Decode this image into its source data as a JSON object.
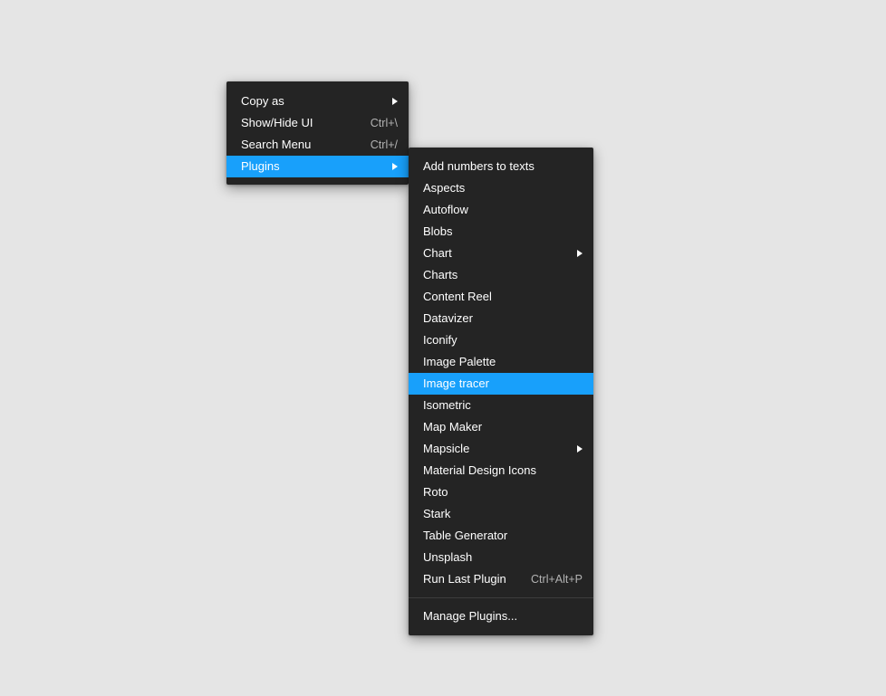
{
  "background_color": "#e5e5e5",
  "accent_color": "#18a0fb",
  "menu_background": "#242424",
  "main_menu": {
    "items": [
      {
        "label": "Copy as",
        "shortcut": "",
        "submenu": true,
        "highlighted": false
      },
      {
        "label": "Show/Hide UI",
        "shortcut": "Ctrl+\\",
        "submenu": false,
        "highlighted": false
      },
      {
        "label": "Search Menu",
        "shortcut": "Ctrl+/",
        "submenu": false,
        "highlighted": false
      },
      {
        "label": "Plugins",
        "shortcut": "",
        "submenu": true,
        "highlighted": true
      }
    ]
  },
  "plugins_submenu": {
    "items": [
      {
        "label": "Add numbers to texts",
        "shortcut": "",
        "submenu": false,
        "highlighted": false
      },
      {
        "label": "Aspects",
        "shortcut": "",
        "submenu": false,
        "highlighted": false
      },
      {
        "label": "Autoflow",
        "shortcut": "",
        "submenu": false,
        "highlighted": false
      },
      {
        "label": "Blobs",
        "shortcut": "",
        "submenu": false,
        "highlighted": false
      },
      {
        "label": "Chart",
        "shortcut": "",
        "submenu": true,
        "highlighted": false
      },
      {
        "label": "Charts",
        "shortcut": "",
        "submenu": false,
        "highlighted": false
      },
      {
        "label": "Content Reel",
        "shortcut": "",
        "submenu": false,
        "highlighted": false
      },
      {
        "label": "Datavizer",
        "shortcut": "",
        "submenu": false,
        "highlighted": false
      },
      {
        "label": "Iconify",
        "shortcut": "",
        "submenu": false,
        "highlighted": false
      },
      {
        "label": "Image Palette",
        "shortcut": "",
        "submenu": false,
        "highlighted": false
      },
      {
        "label": "Image tracer",
        "shortcut": "",
        "submenu": false,
        "highlighted": true
      },
      {
        "label": "Isometric",
        "shortcut": "",
        "submenu": false,
        "highlighted": false
      },
      {
        "label": "Map Maker",
        "shortcut": "",
        "submenu": false,
        "highlighted": false
      },
      {
        "label": "Mapsicle",
        "shortcut": "",
        "submenu": true,
        "highlighted": false
      },
      {
        "label": "Material Design Icons",
        "shortcut": "",
        "submenu": false,
        "highlighted": false
      },
      {
        "label": "Roto",
        "shortcut": "",
        "submenu": false,
        "highlighted": false
      },
      {
        "label": "Stark",
        "shortcut": "",
        "submenu": false,
        "highlighted": false
      },
      {
        "label": "Table Generator",
        "shortcut": "",
        "submenu": false,
        "highlighted": false
      },
      {
        "label": "Unsplash",
        "shortcut": "",
        "submenu": false,
        "highlighted": false
      },
      {
        "label": "Run Last Plugin",
        "shortcut": "Ctrl+Alt+P",
        "submenu": false,
        "highlighted": false
      }
    ],
    "footer_items": [
      {
        "label": "Manage Plugins...",
        "shortcut": "",
        "submenu": false,
        "highlighted": false
      }
    ]
  }
}
